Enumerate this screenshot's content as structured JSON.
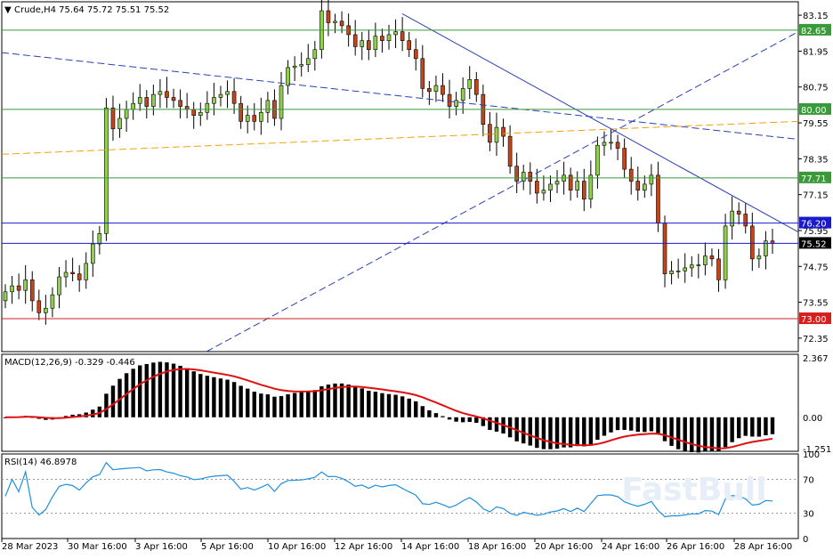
{
  "chart_data": [
    {
      "type": "candlestick",
      "symbol": "Crude",
      "timeframe": "H4",
      "title": "Crude,H4",
      "ohlc_header": "75.64 75.72 75.51 75.52",
      "open": 75.64,
      "high": 75.72,
      "low": 75.51,
      "close": 75.52,
      "ylim": [
        71.9,
        83.6
      ],
      "price_ticks": [
        "83.15",
        "81.95",
        "80.75",
        "79.55",
        "78.35",
        "77.15",
        "75.95",
        "74.75",
        "73.55",
        "72.35"
      ],
      "x_labels": [
        "28 Mar 2023",
        "30 Mar 16:00",
        "3 Apr 16:00",
        "5 Apr 16:00",
        "10 Apr 16:00",
        "12 Apr 16:00",
        "14 Apr 16:00",
        "18 Apr 16:00",
        "20 Apr 16:00",
        "24 Apr 16:00",
        "26 Apr 16:00",
        "28 Apr 16:00"
      ],
      "levels": [
        {
          "value": 82.65,
          "label": "82.65",
          "color": "#3a9a3a"
        },
        {
          "value": 80.0,
          "label": "80.00",
          "color": "#3a9a3a"
        },
        {
          "value": 77.71,
          "label": "77.71",
          "color": "#3a9a3a"
        },
        {
          "value": 76.2,
          "label": "76.20",
          "color": "#1a1acc"
        },
        {
          "value": 73.0,
          "label": "73.00",
          "color": "#d62020"
        }
      ],
      "current_price": {
        "value": 75.52,
        "label": "75.52"
      },
      "bullish_color": "#8fd14f",
      "bearish_color": "#c0461e",
      "closes": [
        73.9,
        74.1,
        73.95,
        74.3,
        73.6,
        73.2,
        73.35,
        73.8,
        74.4,
        74.55,
        74.5,
        74.3,
        74.85,
        75.5,
        75.85,
        80.05,
        79.35,
        79.7,
        80.0,
        80.2,
        80.4,
        80.1,
        80.5,
        80.6,
        80.4,
        80.3,
        80.1,
        80.0,
        79.8,
        79.9,
        80.2,
        80.4,
        80.5,
        80.6,
        80.2,
        79.6,
        79.8,
        79.6,
        79.9,
        80.3,
        79.7,
        80.8,
        81.4,
        81.45,
        81.5,
        81.7,
        82.0,
        83.3,
        82.9,
        82.95,
        82.8,
        82.5,
        82.1,
        82.3,
        82.0,
        82.45,
        82.3,
        82.5,
        82.6,
        82.3,
        82.0,
        81.7,
        80.7,
        80.6,
        80.8,
        80.5,
        80.1,
        80.3,
        80.7,
        81.0,
        80.5,
        79.5,
        78.9,
        79.4,
        79.1,
        78.1,
        77.6,
        77.9,
        77.6,
        77.2,
        77.3,
        77.5,
        77.6,
        77.8,
        77.3,
        77.6,
        77.0,
        77.8,
        78.8,
        78.9,
        78.9,
        78.7,
        78.0,
        77.6,
        77.3,
        77.5,
        77.8,
        76.2,
        74.5,
        74.6,
        74.6,
        74.7,
        74.8,
        74.8,
        75.1,
        75.0,
        74.3,
        76.1,
        76.6,
        76.5,
        76.1,
        75.0,
        75.1,
        75.6,
        75.52
      ],
      "macd": {
        "label": "MACD(12,26,9) -0.329 -0.446",
        "fast": -0.329,
        "signal": -0.446,
        "ylim": [
          -1.35,
          2.5
        ],
        "ticks": [
          "2.367",
          "0.00",
          "-1.251"
        ]
      },
      "rsi": {
        "label": "RSI(14) 46.8978",
        "value": 46.8978,
        "ylim": [
          0,
          100
        ],
        "ticks": [
          "100",
          "70",
          "30",
          "0"
        ]
      }
    }
  ],
  "watermark": "FastBull"
}
